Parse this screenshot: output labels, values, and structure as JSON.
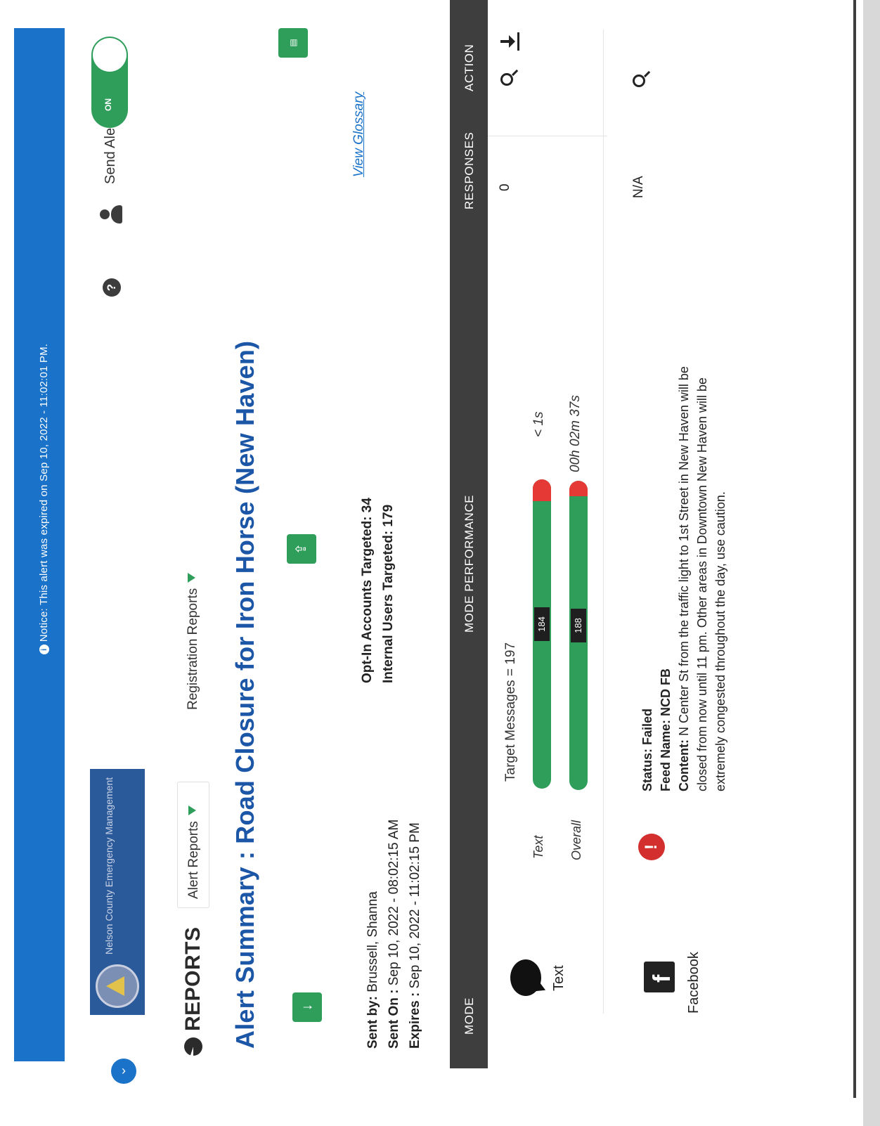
{
  "notice": {
    "info_icon": "info-icon",
    "text": "Notice: This alert was expired on Sep 10, 2022 - 11:02:01 PM."
  },
  "org": {
    "name": "Nelson County Emergency Management"
  },
  "header": {
    "send_alerts_label": "Send Alerts",
    "toggle_state": "ON"
  },
  "reports": {
    "title": "REPORTS",
    "tabs": [
      {
        "label": "Alert Reports"
      },
      {
        "label": "Registration Reports"
      }
    ]
  },
  "summary": {
    "title": "Alert Summary : Road Closure for Iron Horse (New Haven)",
    "view_glossary": "View Glossary",
    "sent_by_label": "Sent by:",
    "sent_by_value": "Brussell, Shanna",
    "sent_on_label": "Sent On :",
    "sent_on_value": "Sep 10, 2022 - 08:02:15 AM",
    "expires_label": "Expires :",
    "expires_value": "Sep 10, 2022 - 11:02:15 PM",
    "opt_in_targeted": "Opt-In Accounts Targeted: 34",
    "internal_targeted": "Internal Users Targeted: 179"
  },
  "table": {
    "headers": [
      "MODE",
      "MODE PERFORMANCE",
      "RESPONSES",
      "ACTION"
    ],
    "rows": [
      {
        "mode": "Text",
        "target_messages": "Target Messages = 197",
        "bars": [
          {
            "label": "Text",
            "count": "184",
            "time": "< 1s",
            "success_fraction": 0.93
          },
          {
            "label": "Overall",
            "count": "188",
            "time": "00h 02m 37s",
            "success_fraction": 0.95
          }
        ],
        "responses": "0"
      },
      {
        "mode": "Facebook",
        "status": "Status: Failed",
        "feed_name": "Feed Name: NCD FB",
        "content_label": "Content:",
        "content": "N Center St from the traffic light to 1st Street in New Haven will be closed from now until 11 pm. Other areas in Downtown New Haven will be extremely congested throughout the day, use caution.",
        "responses": "N/A"
      }
    ]
  },
  "colors": {
    "accent_blue": "#1a73c9",
    "title_blue": "#1c56a6",
    "success_green": "#2f9e5b",
    "error_red": "#e53935",
    "table_header": "#3e3e3e"
  }
}
